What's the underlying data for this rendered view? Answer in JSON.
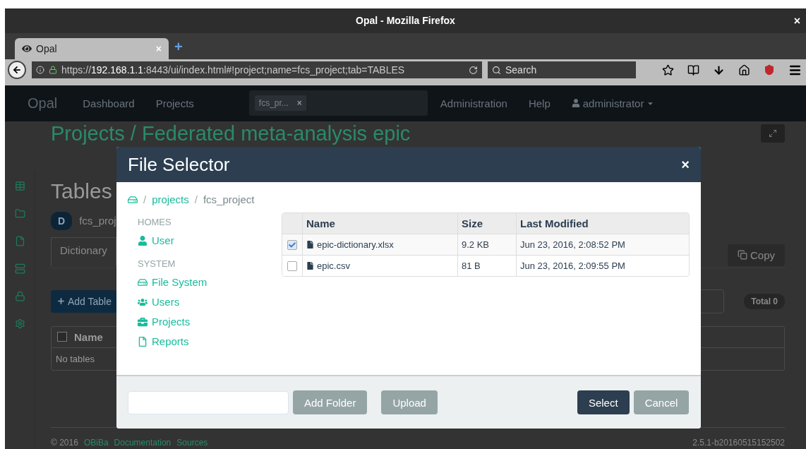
{
  "browser": {
    "title": "Opal - Mozilla Firefox",
    "close": "×",
    "tab": {
      "label": "Opal",
      "close": "×"
    },
    "new_tab": "+",
    "url": {
      "scheme": "https://",
      "host": "192.168.1.1",
      "path": ":8443/ui/index.html#!project;name=fcs_project;tab=TABLES"
    },
    "search": {
      "placeholder": "Search"
    }
  },
  "navbar": {
    "brand": "Opal",
    "links": [
      "Dashboard",
      "Projects"
    ],
    "search_tag": {
      "label": "fcs_pr...",
      "remove": "×"
    },
    "right_links": [
      "Administration",
      "Help"
    ],
    "user": "administrator"
  },
  "page": {
    "title": "Projects / Federated meta-analysis epic",
    "section": "Tables",
    "datasource": {
      "badge": "D",
      "name": "fcs_proj"
    },
    "tab": "Dictionary",
    "copy_button": "Copy",
    "add_button": "Add Table",
    "total": "Total 0",
    "table": {
      "column": "Name",
      "checked": false,
      "empty": "No tables"
    },
    "footer": {
      "copyright": "© 2016",
      "links": [
        "OBiBa",
        "Documentation",
        "Sources"
      ],
      "version": "2.5.1-b20160515152502"
    }
  },
  "dialog": {
    "title": "File Selector",
    "close": "×",
    "breadcrumb": [
      {
        "separator": "/",
        "label": "projects",
        "link": true
      },
      {
        "separator": "/",
        "label": "fcs_project",
        "link": false
      }
    ],
    "groups": [
      {
        "heading": "HOMES",
        "items": [
          "User"
        ]
      },
      {
        "heading": "SYSTEM",
        "items": [
          "File System",
          "Users",
          "Projects",
          "Reports"
        ]
      }
    ],
    "columns": [
      "Name",
      "Size",
      "Last Modified"
    ],
    "files": [
      {
        "name": "epic-dictionary.xlsx",
        "size": "9.2 KB",
        "modified": "Jun 23, 2016, 2:08:52 PM",
        "checked": true
      },
      {
        "name": "epic.csv",
        "size": "81 B",
        "modified": "Jun 23, 2016, 2:09:55 PM",
        "checked": false
      }
    ],
    "buttons": [
      {
        "label": "Add Folder",
        "kind": "secondary"
      },
      {
        "label": "Upload",
        "kind": "secondary"
      },
      {
        "label": "Select",
        "kind": "primary"
      },
      {
        "label": "Cancel",
        "kind": "secondary"
      }
    ]
  }
}
